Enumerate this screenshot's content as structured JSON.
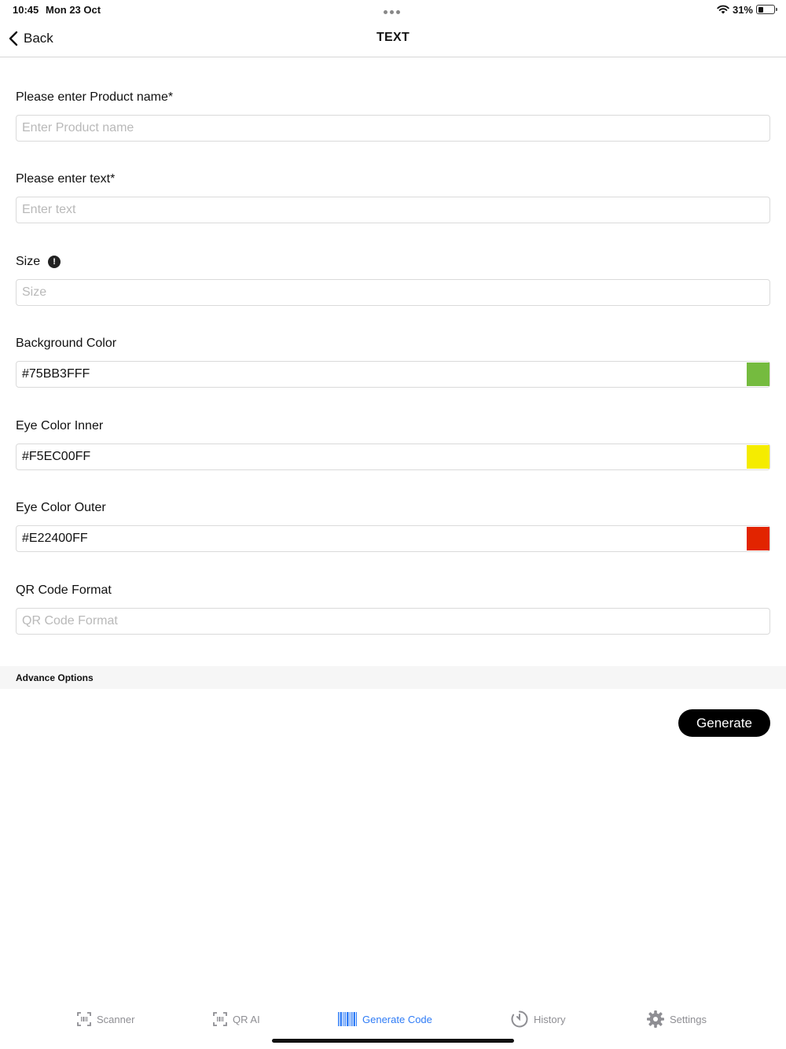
{
  "status_bar": {
    "time": "10:45",
    "date": "Mon 23 Oct",
    "battery_percent": "31%",
    "battery_level": 0.31
  },
  "nav": {
    "back_label": "Back",
    "title": "TEXT"
  },
  "form": {
    "product_name": {
      "label": "Please enter Product name*",
      "placeholder": "Enter Product name",
      "value": ""
    },
    "text": {
      "label": "Please enter text*",
      "placeholder": "Enter text",
      "value": ""
    },
    "size": {
      "label": "Size",
      "info_icon": "!",
      "placeholder": "Size",
      "value": ""
    },
    "background_color": {
      "label": "Background Color",
      "value": "#75BB3FFF",
      "swatch": "#75BB3F"
    },
    "eye_color_inner": {
      "label": "Eye Color Inner",
      "value": "#F5EC00FF",
      "swatch": "#F5EC00"
    },
    "eye_color_outer": {
      "label": "Eye Color Outer",
      "value": "#E22400FF",
      "swatch": "#E22400"
    },
    "qr_code_format": {
      "label": "QR Code Format",
      "placeholder": "QR Code Format",
      "value": ""
    }
  },
  "advance_options_label": "Advance Options",
  "generate_label": "Generate",
  "tabs": [
    {
      "label": "Scanner",
      "icon": "scanner-icon",
      "active": false
    },
    {
      "label": "QR AI",
      "icon": "qr-ai-icon",
      "active": false
    },
    {
      "label": "Generate Code",
      "icon": "barcode-icon",
      "active": true
    },
    {
      "label": "History",
      "icon": "history-icon",
      "active": false
    },
    {
      "label": "Settings",
      "icon": "gear-icon",
      "active": false
    }
  ],
  "colors": {
    "accent": "#2F7CF6",
    "inactive": "#8E8E93"
  }
}
